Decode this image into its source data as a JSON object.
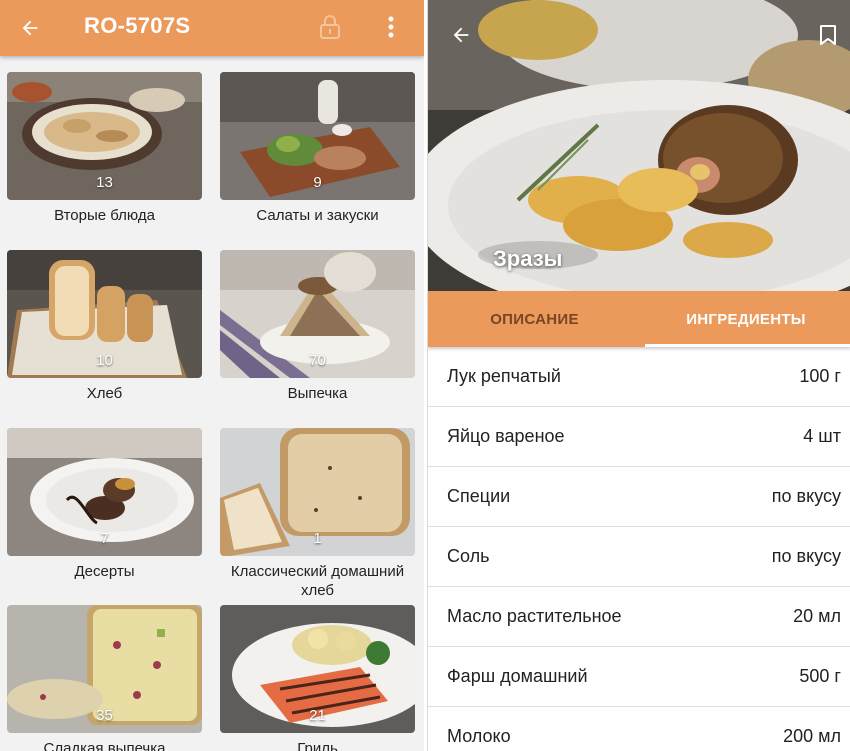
{
  "left": {
    "title": "RO-5707S",
    "categories": [
      {
        "label": "Вторые блюда",
        "count": "13"
      },
      {
        "label": "Салаты и закуски",
        "count": "9"
      },
      {
        "label": "Хлеб",
        "count": "10"
      },
      {
        "label": "Выпечка",
        "count": "70"
      },
      {
        "label": "Десерты",
        "count": "7"
      },
      {
        "label": "Классический домашний хлеб",
        "count": "1"
      },
      {
        "label": "Сладкая выпечка",
        "count": "35"
      },
      {
        "label": "Гриль",
        "count": "21"
      }
    ]
  },
  "right": {
    "dish_title": "Зразы",
    "tabs": [
      {
        "label": "ОПИСАНИЕ",
        "active": false
      },
      {
        "label": "ИНГРЕДИЕНТЫ",
        "active": true
      }
    ],
    "ingredients": [
      {
        "name": "Лук репчатый",
        "qty": "100 г"
      },
      {
        "name": "Яйцо вареное",
        "qty": "4 шт"
      },
      {
        "name": "Специи",
        "qty": "по вкусу"
      },
      {
        "name": "Соль",
        "qty": "по вкусу"
      },
      {
        "name": "Масло растительное",
        "qty": "20 мл"
      },
      {
        "name": "Фарш домашний",
        "qty": "500 г"
      },
      {
        "name": "Молоко",
        "qty": "200 мл"
      }
    ]
  },
  "colors": {
    "accent": "#ec9a5b",
    "inactive_tab_text": "#7a4523",
    "background": "#f2f2f2"
  },
  "icons": [
    "back-arrow-icon",
    "lock-icon",
    "more-vertical-icon",
    "bookmark-icon"
  ]
}
